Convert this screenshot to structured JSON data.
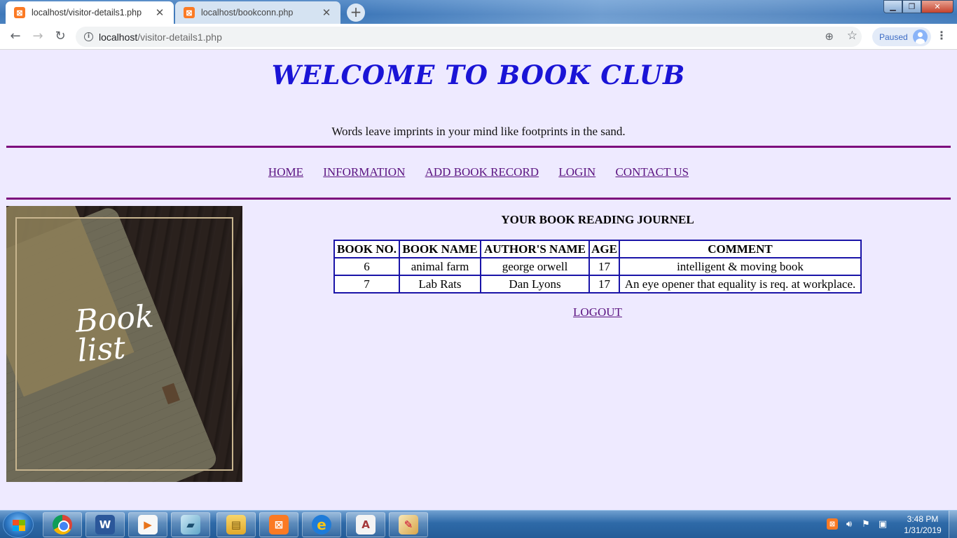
{
  "browser": {
    "tabs": [
      {
        "title": "localhost/visitor-details1.php",
        "active": true
      },
      {
        "title": "localhost/bookconn.php",
        "active": false
      }
    ],
    "new_tab_symbol": "+",
    "address": {
      "host": "localhost",
      "path": "/visitor-details1.php"
    },
    "profile_status": "Paused",
    "icons": [
      "back-arrow-icon",
      "forward-arrow-icon",
      "reload-icon",
      "info-icon",
      "zoom-icon",
      "star-icon",
      "avatar-icon",
      "menu-icon"
    ]
  },
  "site": {
    "title": "WELCOME TO BOOK CLUB",
    "tagline": "Words leave imprints in your mind like footprints in the sand.",
    "nav": [
      "HOME",
      "INFORMATION",
      "ADD BOOK RECORD",
      "LOGIN",
      "CONTACT US"
    ],
    "image_text": "Book list"
  },
  "journal": {
    "title": "YOUR BOOK READING JOURNEL",
    "columns": [
      "BOOK NO.",
      "BOOK NAME",
      "AUTHOR'S NAME",
      "AGE",
      "COMMENT"
    ],
    "rows": [
      [
        "6",
        "animal farm",
        "george orwell",
        "17",
        "intelligent & moving book"
      ],
      [
        "7",
        "Lab Rats",
        "Dan Lyons",
        "17",
        "An eye opener that equality is req. at workplace."
      ]
    ],
    "logout": "LOGOUT"
  },
  "taskbar": {
    "apps": [
      "chrome",
      "word",
      "media-player",
      "magnifier",
      "file-explorer",
      "xampp",
      "internet-explorer",
      "access",
      "paint"
    ],
    "time": "3:48 PM",
    "date": "1/31/2019"
  },
  "colors": {
    "page_bg": "#eeeaff",
    "title": "#1a14d6",
    "rule": "#7d0a7d",
    "link": "#5a1380",
    "table_border": "#1a14a8"
  }
}
